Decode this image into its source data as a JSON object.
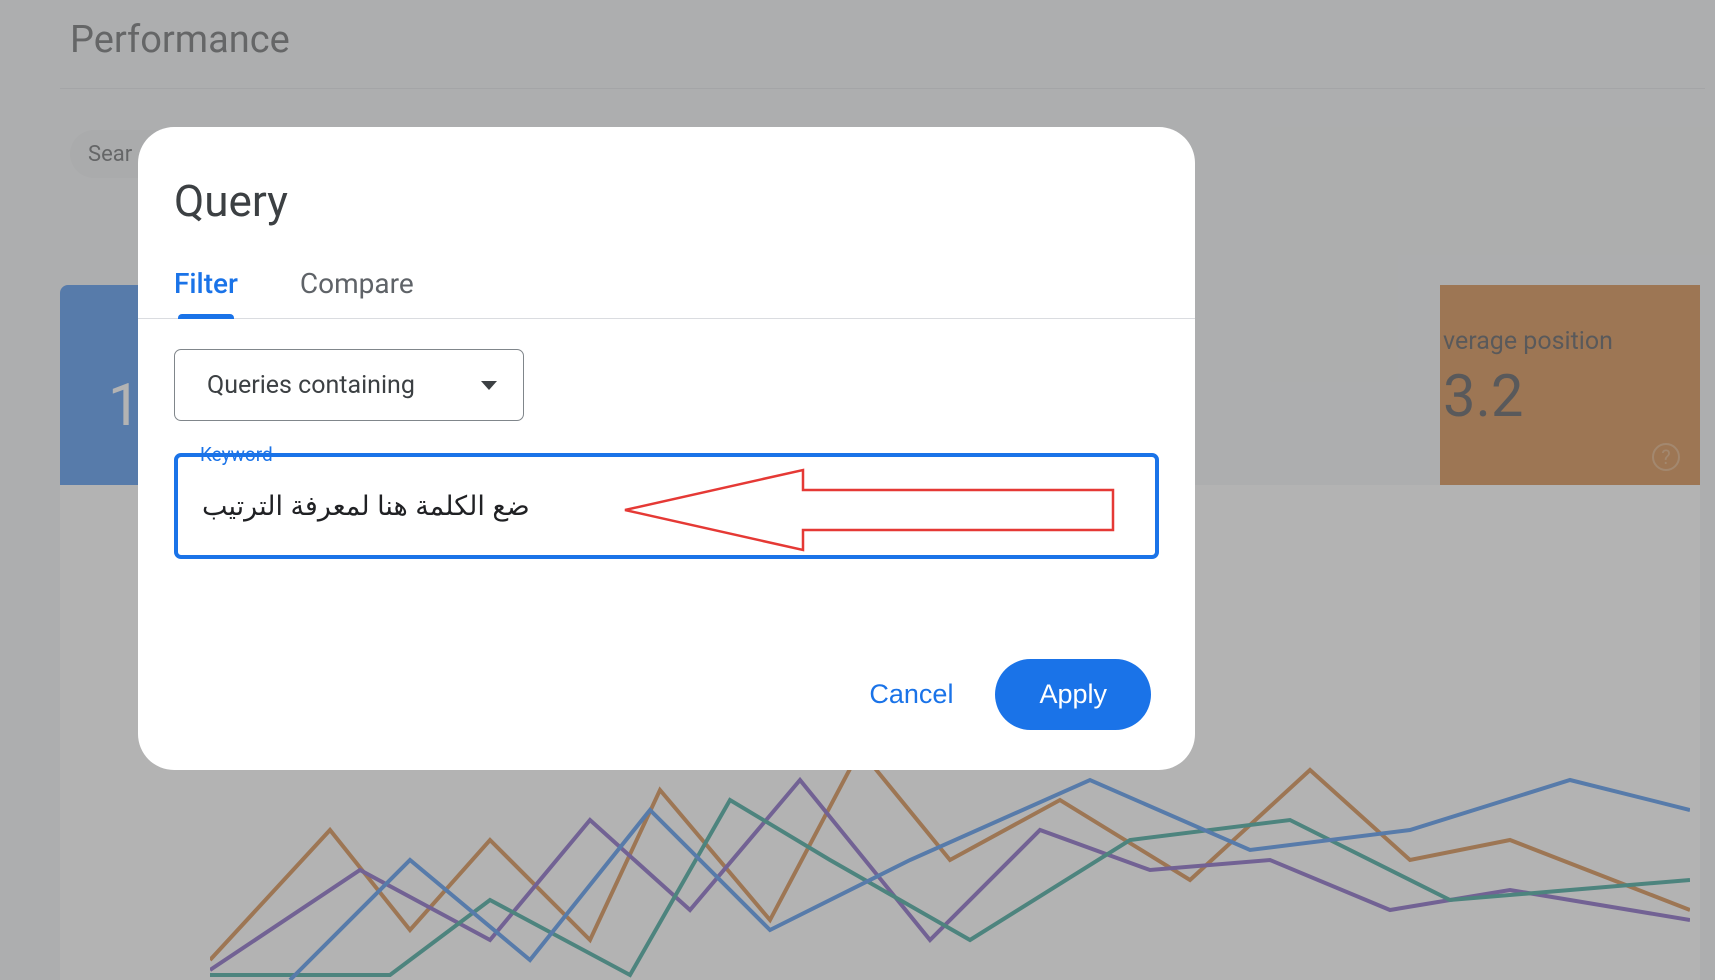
{
  "page": {
    "title": "Performance",
    "chip_search_type": "Sear",
    "card_blue_value": "1",
    "card_orange_label": "verage position",
    "card_orange_value": "3.2"
  },
  "dialog": {
    "title": "Query",
    "tabs": {
      "filter": "Filter",
      "compare": "Compare"
    },
    "dropdown_label": "Queries containing",
    "field_label": "Keyword",
    "field_value": "ضع الكلمة هنا لمعرفة الترتيب",
    "actions": {
      "cancel": "Cancel",
      "apply": "Apply"
    }
  }
}
